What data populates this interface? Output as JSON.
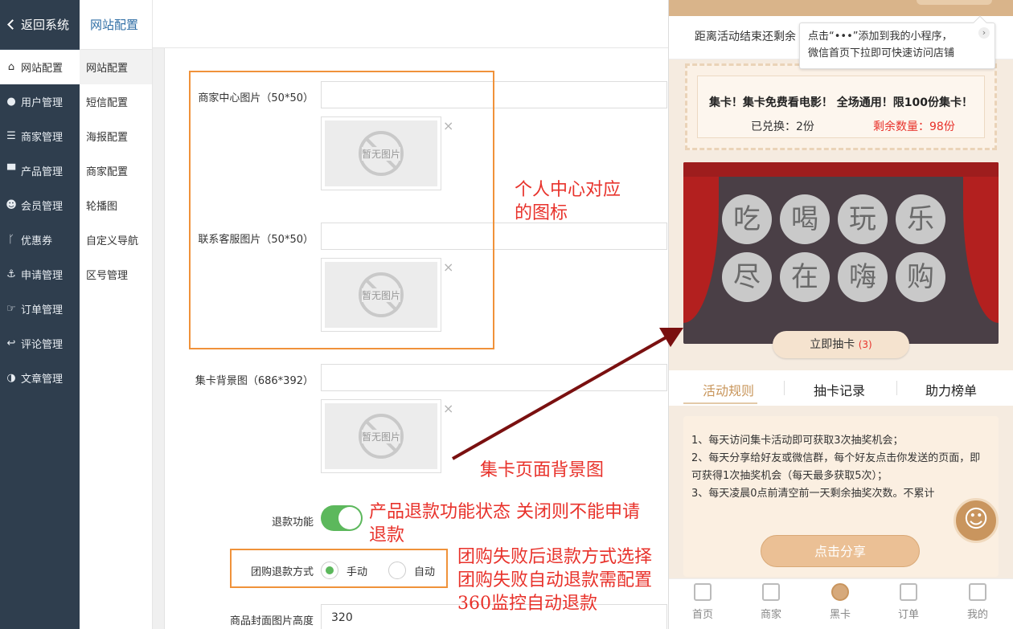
{
  "sidebar": {
    "back_label": "返回系统",
    "items": [
      {
        "label": "网站配置",
        "icon": "home-icon"
      },
      {
        "label": "用户管理",
        "icon": "user-icon"
      },
      {
        "label": "商家管理",
        "icon": "server-icon"
      },
      {
        "label": "产品管理",
        "icon": "cart-icon"
      },
      {
        "label": "会员管理",
        "icon": "users-icon"
      },
      {
        "label": "优惠券",
        "icon": "branch-icon"
      },
      {
        "label": "申请管理",
        "icon": "anchor-icon"
      },
      {
        "label": "订单管理",
        "icon": "hand-icon"
      },
      {
        "label": "评论管理",
        "icon": "reply-icon"
      },
      {
        "label": "文章管理",
        "icon": "contrast-icon"
      }
    ]
  },
  "submenu": {
    "title": "网站配置",
    "items": [
      "网站配置",
      "短信配置",
      "海报配置",
      "商家配置",
      "轮播图",
      "自定义导航",
      "区号管理"
    ]
  },
  "form": {
    "merchant_center_label": "商家中心图片（50*50）",
    "contact_service_label": "联系客服图片（50*50）",
    "card_bg_label": "集卡背景图（686*392）",
    "no_image_text": "暂无图片",
    "refund_label": "退款功能",
    "group_refund_label": "团购退款方式",
    "manual_label": "手动",
    "auto_label": "自动",
    "cover_height_label": "商品封面图片高度",
    "cover_height_value": "320",
    "delete_mark": "×"
  },
  "annotations": {
    "personal_center": [
      "个人中心对应",
      "的图标"
    ],
    "card_bg": "集卡页面背景图",
    "refund": [
      "产品退款功能状态  关闭则不能申请",
      "退款"
    ],
    "group_refund": [
      "团购失败后退款方式选择",
      "团购失败自动退款需配置",
      "360监控自动退款"
    ],
    "colors": {
      "annotation_red": "#e8322b",
      "box_orange": "#f0923a",
      "arrow_darkred": "#7a1010"
    }
  },
  "phone": {
    "countdown": "距离活动结束还剩余",
    "tip_lines": [
      "点击“•••”添加到我的小程序，",
      "微信首页下拉即可快速访问店铺"
    ],
    "coupon": {
      "title": "集卡！集卡免费看电影！ 全场通用！限100份集卡！",
      "redeemed": "已兑换：2份",
      "remaining": "剩余数量：98份"
    },
    "banner_chars": [
      "吃",
      "喝",
      "玩",
      "乐",
      "尽",
      "在",
      "嗨",
      "购"
    ],
    "draw_button": "立即抽卡",
    "draw_count": "(3)",
    "tabs": [
      "活动规则",
      "抽卡记录",
      "助力榜单"
    ],
    "rules": [
      "1、每天访问集卡活动即可获取3次抽奖机会；",
      "2、每天分享给好友或微信群，每个好友点击你发送的页面，即可获得1次抽奖机会（每天最多获取5次）；",
      "3、每天凌晨0点前清空前一天剩余抽奖次数。不累计"
    ],
    "share_button": "点击分享",
    "bottom_nav": [
      "首页",
      "商家",
      "黑卡",
      "订单",
      "我的"
    ]
  }
}
